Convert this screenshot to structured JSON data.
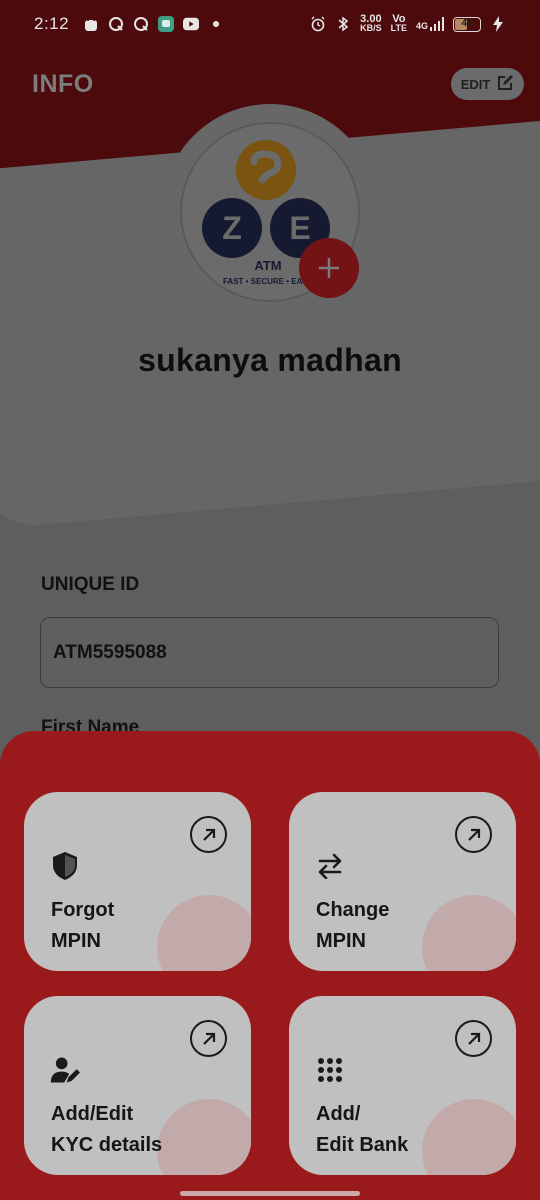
{
  "status_bar": {
    "time": "2:12",
    "speed_value": "3.00",
    "speed_unit": "KB/S",
    "network_top": "Vo",
    "network_bottom": "LTE",
    "signal_label": "4G",
    "battery_level": "49",
    "battery_fraction": 0.49
  },
  "header": {
    "title": "INFO",
    "edit_label": "EDIT"
  },
  "profile": {
    "logo_letters": [
      "Z",
      "E"
    ],
    "logo_caption": "ATM",
    "logo_tagline": "FAST • SECURE • EASY",
    "name": "sukanya madhan"
  },
  "form": {
    "unique_id_label": "UNIQUE ID",
    "unique_id_value": "ATM5595088",
    "first_name_label": "First Name"
  },
  "actions": [
    {
      "line1": "Forgot",
      "line2": "MPIN",
      "icon": "shield-icon"
    },
    {
      "line1": "Change",
      "line2": "MPIN",
      "icon": "swap-arrows-icon"
    },
    {
      "line1": "Add/Edit",
      "line2": "KYC details",
      "icon": "user-edit-icon"
    },
    {
      "line1": "Add/",
      "line2": "Edit Bank",
      "icon": "grid-dots-icon"
    }
  ],
  "colors": {
    "header_bg": "#4c0a0c",
    "sheet_bg": "#9a1a1c",
    "card_bg": "#c0c0c0",
    "accent_red": "#731316"
  }
}
